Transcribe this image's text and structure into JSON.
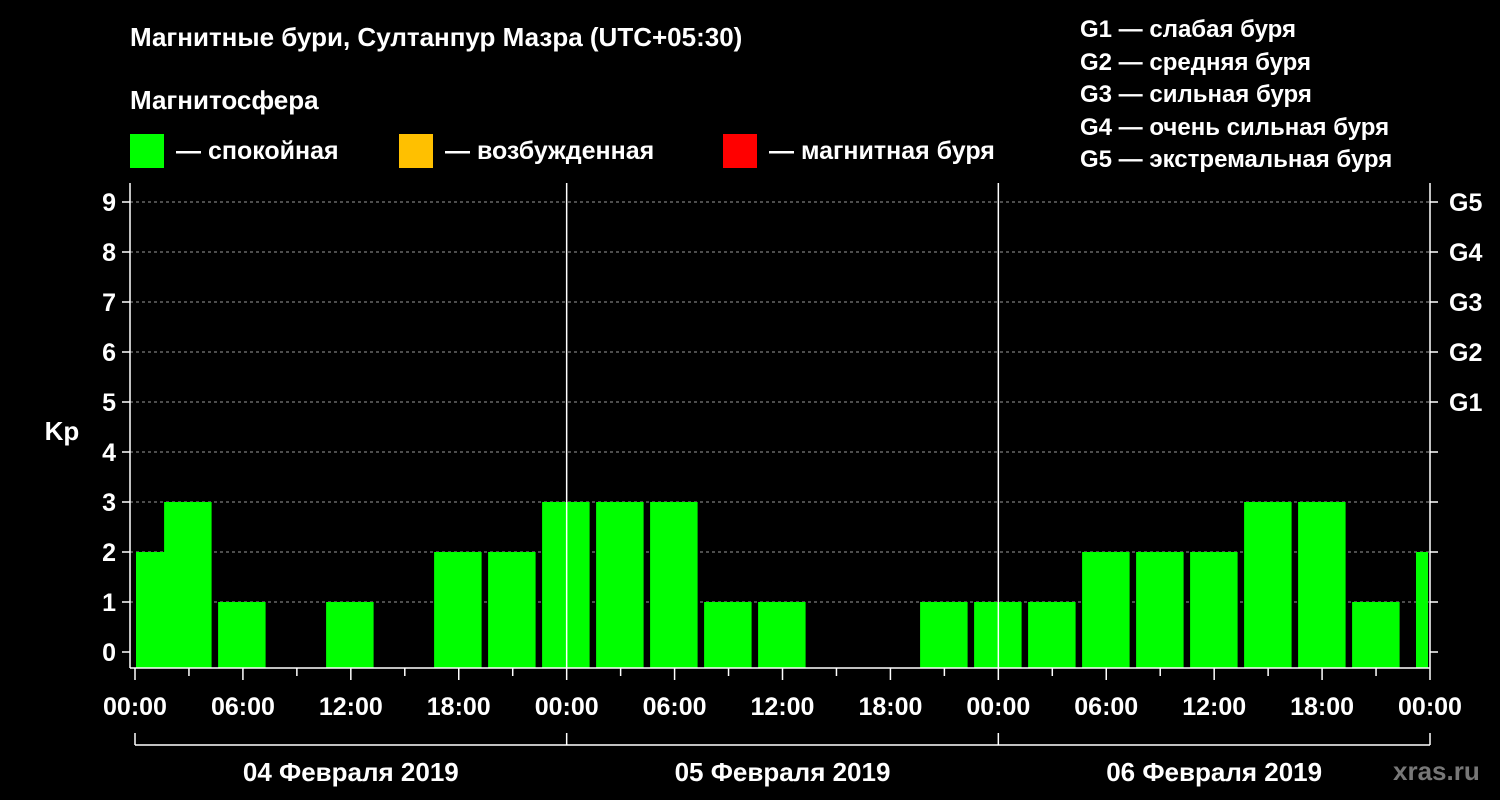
{
  "chart_data": {
    "type": "bar",
    "title": "Магнитные бури, Султанпур Мазра (UTC+05:30)",
    "subtitle": "Магнитосфера",
    "ylabel": "Kp",
    "ylim": [
      0,
      9
    ],
    "yticks": [
      "0",
      "1",
      "2",
      "3",
      "4",
      "5",
      "6",
      "7",
      "8",
      "9"
    ],
    "right_ticks": [
      {
        "kp": 5,
        "label": "G1"
      },
      {
        "kp": 6,
        "label": "G2"
      },
      {
        "kp": 7,
        "label": "G3"
      },
      {
        "kp": 8,
        "label": "G4"
      },
      {
        "kp": 9,
        "label": "G5"
      }
    ],
    "xtick_labels": [
      "00:00",
      "06:00",
      "12:00",
      "18:00",
      "00:00",
      "06:00",
      "12:00",
      "18:00",
      "00:00",
      "06:00",
      "12:00",
      "18:00",
      "00:00"
    ],
    "days": [
      "04 Февраля 2019",
      "05 Февраля 2019",
      "06 Февраля 2019"
    ],
    "legend": [
      {
        "label": "— спокойная",
        "color": "#00ff00"
      },
      {
        "label": "— возбужденная",
        "color": "#ffc000"
      },
      {
        "label": "— магнитная буря",
        "color": "#ff0000"
      }
    ],
    "g_scale": [
      "G1 — слабая буря",
      "G2 — средняя буря",
      "G3 — сильная буря",
      "G4 — очень сильная буря",
      "G5 — экстремальная буря"
    ],
    "bar_color": "#00ff00",
    "grid": true,
    "values": [
      2,
      3,
      1,
      0,
      1,
      0,
      2,
      2,
      3,
      3,
      3,
      1,
      1,
      0,
      0,
      1,
      1,
      1,
      2,
      2,
      2,
      3,
      3,
      1,
      2
    ]
  },
  "watermark": "xras.ru"
}
